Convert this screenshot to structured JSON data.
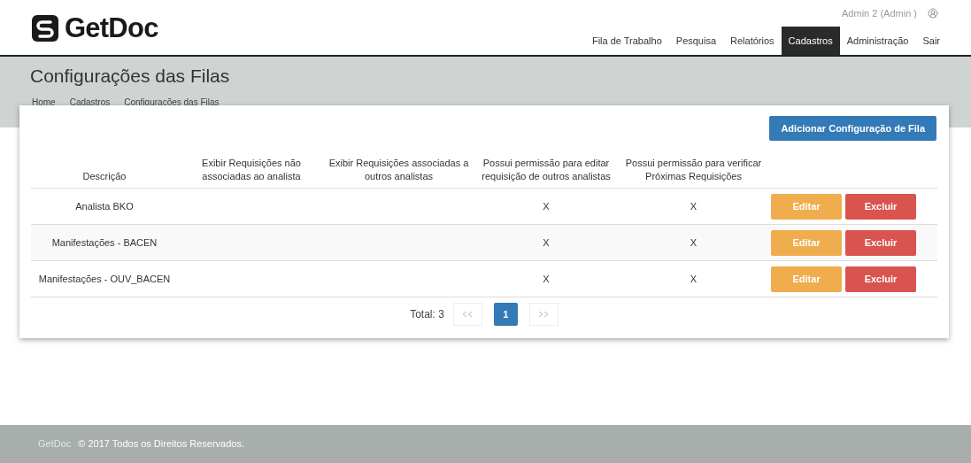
{
  "header": {
    "logo_text": "GetDoc",
    "user": "Admin 2 (Admin )",
    "nav": [
      {
        "label": "Fila de Trabalho",
        "selected": false
      },
      {
        "label": "Pesquisa",
        "selected": false
      },
      {
        "label": "Relatórios",
        "selected": false
      },
      {
        "label": "Cadastros",
        "selected": true
      },
      {
        "label": "Administração",
        "selected": false
      },
      {
        "label": "Sair",
        "selected": false
      }
    ]
  },
  "page": {
    "title": "Configurações das Filas",
    "breadcrumb": [
      "Home",
      "Cadastros",
      "Configurações das Filas"
    ]
  },
  "card": {
    "add_button": "Adicionar Configuração de Fila",
    "table": {
      "columns": [
        "Descrição",
        "Exibir Requisições não associadas ao analista",
        "Exibir Requisições associadas a outros analistas",
        "Possui permissão para editar requisição de outros analistas",
        "Possui permissão para verificar Próximas Requisições"
      ],
      "rows": [
        {
          "cells": [
            "Analista BKO",
            null,
            null,
            "X",
            "X"
          ],
          "edit": "Editar",
          "delete": "Excluir"
        },
        {
          "cells": [
            "Manifestações - BACEN",
            null,
            null,
            "X",
            "X"
          ],
          "edit": "Editar",
          "delete": "Excluir"
        },
        {
          "cells": [
            "Manifestações - OUV_BACEN",
            null,
            null,
            "X",
            "X"
          ],
          "edit": "Editar",
          "delete": "Excluir"
        }
      ]
    },
    "pagination": {
      "total": "Total: 3",
      "pages": [
        {
          "label": "1",
          "selected": true
        }
      ]
    }
  },
  "footer": {
    "brand": "GetDoc",
    "copyright": "© 2017 Todos os Direitos Reservados."
  }
}
